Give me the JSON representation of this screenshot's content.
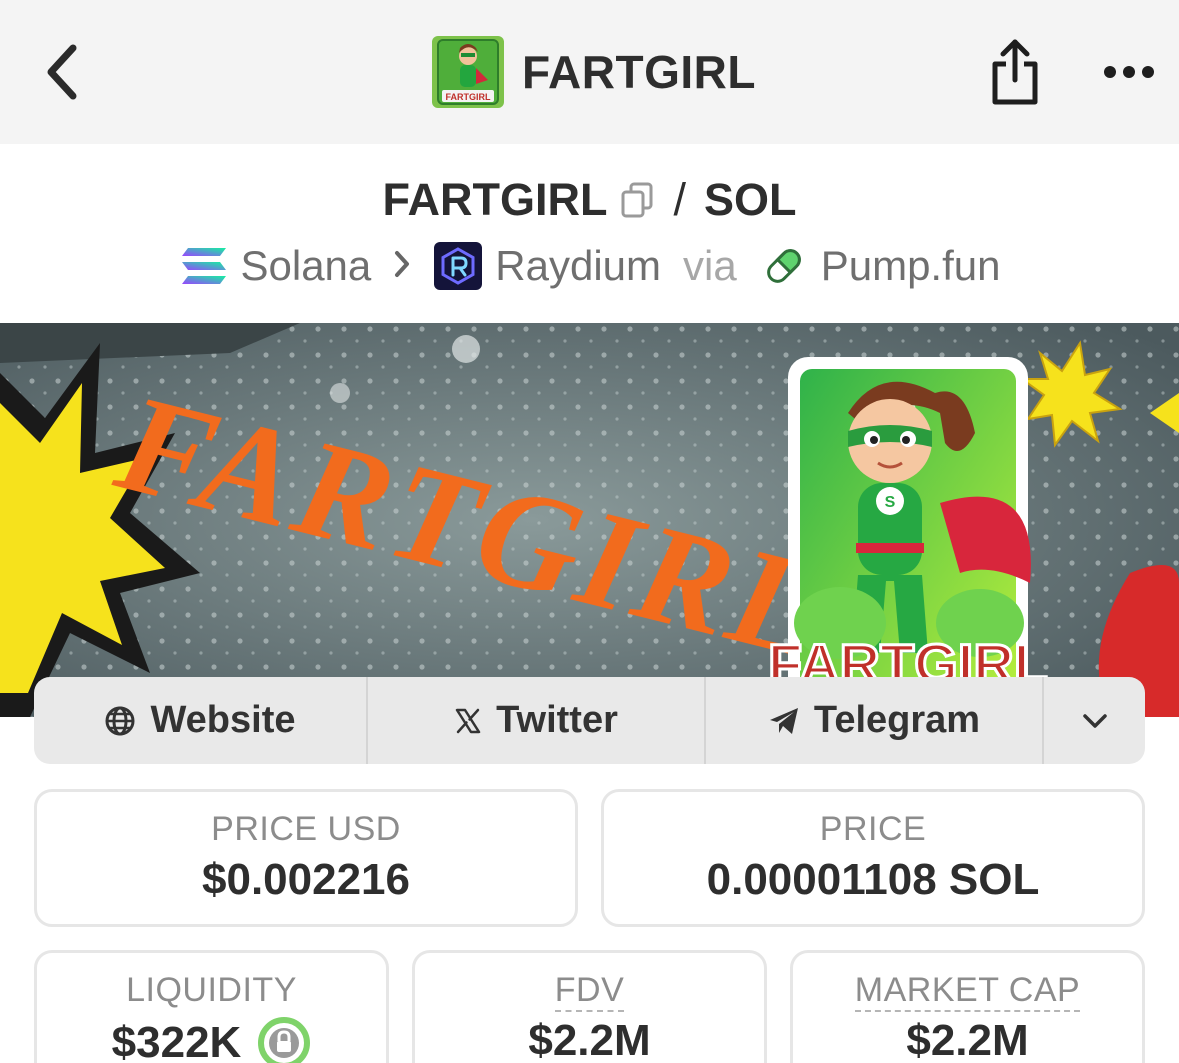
{
  "nav": {
    "title": "FARTGIRL",
    "back_icon": "chevron-left-icon",
    "share_icon": "share-icon",
    "more_icon": "more-horizontal-icon",
    "avatar_caption": "FARTGIRL"
  },
  "pair": {
    "base": "FARTGIRL",
    "separator": "/",
    "quote": "SOL",
    "copy_icon": "copy-icon"
  },
  "route": {
    "chain": "Solana",
    "dex": "Raydium",
    "via": "via",
    "launchpad": "Pump.fun"
  },
  "banner": {
    "title_text": "FARTGIRL",
    "card_caption": "FARTGIRL"
  },
  "links": {
    "website": "Website",
    "twitter": "Twitter",
    "telegram": "Telegram",
    "more_icon": "chevron-down-icon"
  },
  "stats": {
    "price_usd_label": "PRICE USD",
    "price_usd_value": "$0.002216",
    "price_label": "PRICE",
    "price_value": "0.00001108 SOL",
    "liquidity_label": "LIQUIDITY",
    "liquidity_value": "$322K",
    "fdv_label": "FDV",
    "fdv_value": "$2.2M",
    "market_cap_label": "MARKET CAP",
    "market_cap_value": "$2.2M"
  },
  "colors": {
    "accent_green": "#3ec05a",
    "banner_orange": "#f26b1d",
    "banner_yellow": "#f7e21b",
    "lock_green": "#7fd36a"
  }
}
